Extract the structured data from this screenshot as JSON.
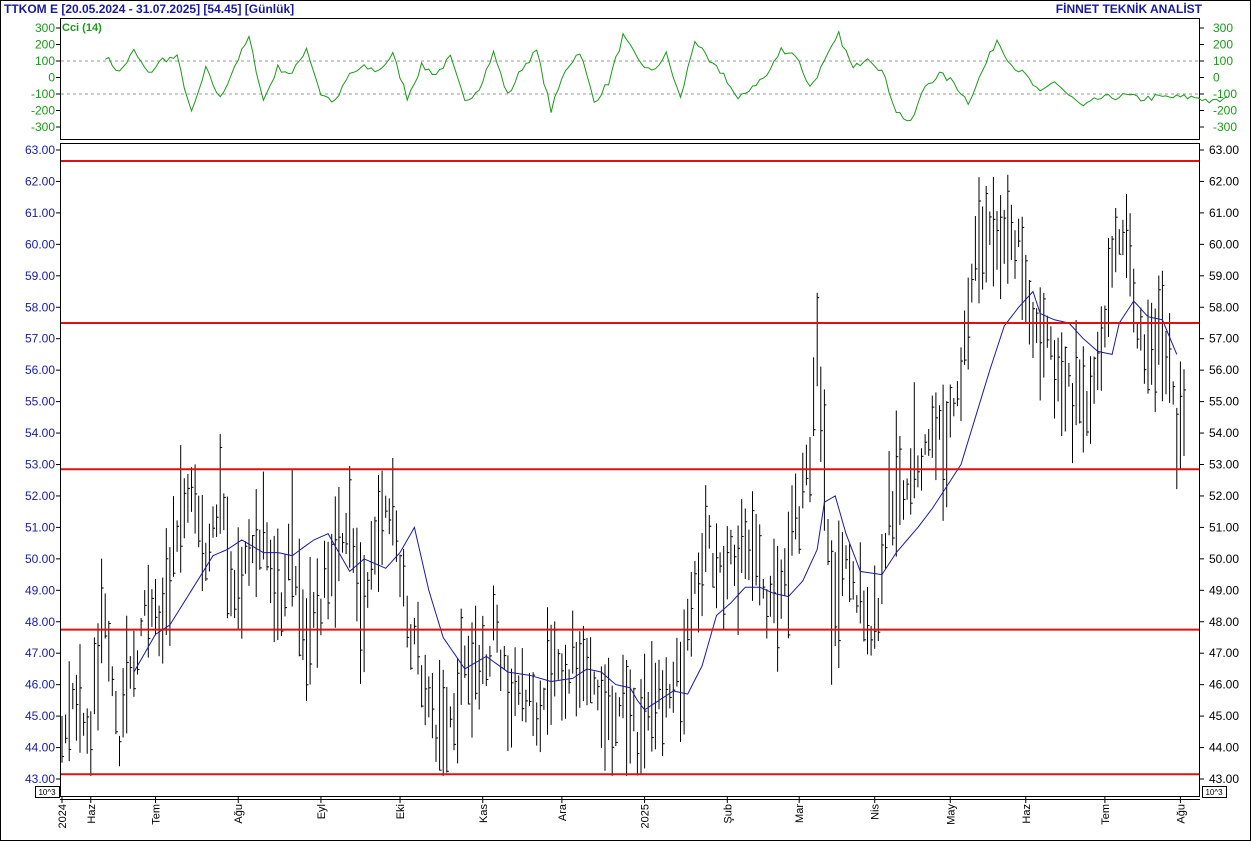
{
  "header": {
    "title": "TTKOM E  [20.05.2024 - 31.07.2025]  [54.45]  [Günlük]",
    "brand": "FİNNET TEKNİK ANALİST"
  },
  "cci_panel": {
    "label": "Cci (14)",
    "color": "#1a9a1a",
    "ylim": [
      -350,
      350
    ],
    "ticks": [
      "300",
      "200",
      "100",
      "0",
      "-100",
      "-200",
      "-300"
    ],
    "dashed_levels": [
      100,
      -100
    ]
  },
  "price_panel": {
    "ylim": [
      43,
      63
    ],
    "ticks": [
      "63.00",
      "62.00",
      "61.00",
      "60.00",
      "59.00",
      "58.00",
      "57.00",
      "56.00",
      "55.00",
      "54.00",
      "53.00",
      "52.00",
      "51.00",
      "50.00",
      "49.00",
      "48.00",
      "47.00",
      "46.00",
      "45.00",
      "44.00",
      "43.00"
    ],
    "scale_badge": "10^3",
    "ma_color": "#1a1aa0",
    "levels_color": "#e01010",
    "horizontal_levels": [
      62.65,
      57.5,
      52.85,
      47.75,
      43.15
    ]
  },
  "x_axis": {
    "labels": [
      "2024",
      "Haz",
      "Tem",
      "Ağu",
      "Eyl",
      "Eki",
      "Kas",
      "Ara",
      "2025",
      "Şub",
      "Mar",
      "Nis",
      "May",
      "Haz",
      "Tem",
      "Ağu"
    ],
    "label_pos": [
      0,
      8,
      26,
      49,
      72,
      94,
      117,
      139,
      162,
      185,
      205,
      226,
      247,
      268,
      290,
      311
    ]
  },
  "chart_data": [
    {
      "type": "line",
      "name": "Cci (14)",
      "x_unit": "trading day index (0 = 20.05.2024, 312 = 31.07.2025)",
      "x_keypoints": [
        0,
        4,
        8,
        12,
        16,
        20,
        24,
        28,
        32,
        36,
        40,
        44,
        48,
        52,
        56,
        60,
        64,
        68,
        72,
        76,
        80,
        84,
        88,
        92,
        96,
        100,
        104,
        108,
        112,
        116,
        120,
        124,
        128,
        132,
        136,
        140,
        144,
        148,
        152,
        156,
        160,
        164,
        168,
        172,
        176,
        180,
        184,
        188,
        192,
        196,
        200,
        204,
        208,
        212,
        216,
        220,
        224,
        228,
        232,
        236,
        240,
        244,
        248,
        252,
        256,
        260,
        264,
        268,
        272,
        276,
        280,
        284,
        288,
        292,
        296,
        300,
        304,
        308,
        312
      ],
      "y_keypoints": [
        130,
        30,
        160,
        20,
        110,
        120,
        -220,
        50,
        -130,
        70,
        240,
        -140,
        60,
        20,
        180,
        -100,
        -150,
        20,
        60,
        40,
        140,
        -120,
        70,
        20,
        120,
        -150,
        -60,
        150,
        -110,
        60,
        160,
        -200,
        50,
        160,
        -150,
        -30,
        250,
        110,
        30,
        140,
        -130,
        230,
        90,
        20,
        -140,
        -50,
        10,
        170,
        140,
        -60,
        90,
        260,
        50,
        130,
        40,
        -200,
        -280,
        -50,
        20,
        -30,
        -150,
        40,
        230,
        80,
        10,
        -100,
        -20,
        -110,
        -180,
        -130,
        -120,
        -110,
        -130,
        -120,
        -120,
        -120,
        -120,
        -150,
        -130
      ]
    },
    {
      "type": "line",
      "name": "Moving average",
      "x_keypoints": [
        20,
        26,
        30,
        36,
        42,
        46,
        50,
        56,
        60,
        64,
        70,
        74,
        80,
        84,
        90,
        94,
        98,
        102,
        106,
        112,
        118,
        124,
        130,
        136,
        142,
        146,
        150,
        154,
        158,
        160,
        162,
        166,
        170,
        174,
        178,
        182,
        186,
        190,
        194,
        198,
        202,
        206,
        210,
        212,
        215,
        218,
        222,
        228,
        232,
        238,
        242,
        246,
        250,
        254,
        258,
        262,
        266,
        270,
        272,
        276,
        280,
        284,
        288,
        292,
        294,
        298,
        302,
        306,
        310
      ],
      "y_keypoints": [
        46.4,
        47.6,
        47.9,
        49.0,
        50.1,
        50.3,
        50.6,
        50.2,
        50.2,
        50.1,
        50.6,
        50.8,
        49.6,
        50.0,
        49.7,
        50.2,
        51.0,
        49.0,
        47.5,
        46.5,
        46.9,
        46.4,
        46.3,
        46.1,
        46.2,
        46.5,
        46.4,
        46.0,
        45.9,
        45.5,
        45.2,
        45.5,
        45.8,
        45.7,
        46.6,
        48.2,
        48.6,
        49.1,
        49.1,
        48.9,
        48.8,
        49.3,
        50.3,
        51.8,
        52.0,
        50.8,
        49.6,
        49.5,
        50.2,
        51.0,
        51.6,
        52.3,
        53.0,
        54.5,
        56.0,
        57.4,
        58.0,
        58.5,
        57.8,
        57.6,
        57.5,
        57.0,
        56.6,
        56.5,
        57.5,
        58.2,
        57.7,
        57.6,
        56.5
      ]
    },
    {
      "type": "bar",
      "name": "Daily high-low range",
      "x_unit": "trading day index",
      "ohlc_keypoints": [
        [
          0,
          44.4
        ],
        [
          4,
          45.8
        ],
        [
          8,
          44.5
        ],
        [
          12,
          48.6
        ],
        [
          16,
          44.4
        ],
        [
          20,
          46.8
        ],
        [
          24,
          48.5
        ],
        [
          28,
          47.8
        ],
        [
          32,
          51.2
        ],
        [
          36,
          52.0
        ],
        [
          40,
          50.1
        ],
        [
          44,
          52.1
        ],
        [
          48,
          48.9
        ],
        [
          52,
          50.2
        ],
        [
          56,
          50.8
        ],
        [
          60,
          48.6
        ],
        [
          64,
          50.4
        ],
        [
          68,
          47.2
        ],
        [
          72,
          48.8
        ],
        [
          76,
          50.6
        ],
        [
          80,
          51.6
        ],
        [
          84,
          47.6
        ],
        [
          88,
          51.3
        ],
        [
          92,
          51.4
        ],
        [
          96,
          48.3
        ],
        [
          100,
          46.3
        ],
        [
          104,
          44.5
        ],
        [
          108,
          44.9
        ],
        [
          112,
          46.9
        ],
        [
          116,
          46.4
        ],
        [
          120,
          47.8
        ],
        [
          124,
          45.7
        ],
        [
          128,
          45.7
        ],
        [
          132,
          45.3
        ],
        [
          136,
          46.5
        ],
        [
          140,
          46.1
        ],
        [
          144,
          46.8
        ],
        [
          148,
          46.0
        ],
        [
          152,
          44.7
        ],
        [
          156,
          45.6
        ],
        [
          160,
          44.0
        ],
        [
          164,
          46.0
        ],
        [
          168,
          45.4
        ],
        [
          172,
          46.3
        ],
        [
          176,
          48.8
        ],
        [
          180,
          50.5
        ],
        [
          184,
          49.4
        ],
        [
          188,
          50.1
        ],
        [
          192,
          50.1
        ],
        [
          196,
          48.8
        ],
        [
          200,
          49.0
        ],
        [
          204,
          51.0
        ],
        [
          208,
          53.2
        ],
        [
          210,
          56.8
        ],
        [
          214,
          48.9
        ],
        [
          218,
          49.5
        ],
        [
          222,
          48.8
        ],
        [
          226,
          47.6
        ],
        [
          230,
          51.4
        ],
        [
          234,
          52.3
        ],
        [
          238,
          52.9
        ],
        [
          242,
          54.3
        ],
        [
          246,
          53.8
        ],
        [
          250,
          56.1
        ],
        [
          254,
          59.7
        ],
        [
          258,
          60.2
        ],
        [
          262,
          60.5
        ],
        [
          266,
          59.8
        ],
        [
          270,
          57.0
        ],
        [
          274,
          57.3
        ],
        [
          278,
          56.0
        ],
        [
          282,
          54.8
        ],
        [
          286,
          55.3
        ],
        [
          290,
          58.0
        ],
        [
          294,
          60.6
        ],
        [
          298,
          58.3
        ],
        [
          302,
          56.1
        ],
        [
          306,
          57.4
        ],
        [
          310,
          54.4
        ],
        [
          312,
          54.45
        ]
      ]
    }
  ]
}
